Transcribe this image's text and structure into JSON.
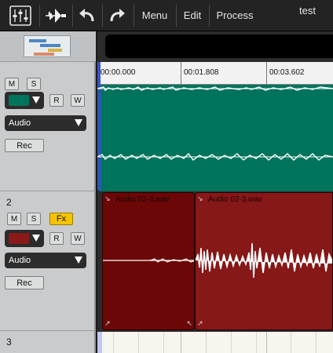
{
  "toolbar": {
    "mixer_icon": "mixer-faders-icon",
    "tool_icon": "waveform-tool-icon",
    "undo_icon": "undo-arrow-icon",
    "redo_icon": "redo-arrow-icon",
    "menu_label": "Menu",
    "edit_label": "Edit",
    "process_label": "Process",
    "project_title": "test"
  },
  "ruler": {
    "marks": [
      "00:00.000",
      "00:01.808",
      "00:03.602"
    ]
  },
  "tracks": [
    {
      "number": "",
      "mute": "M",
      "solo": "S",
      "read": "R",
      "write": "W",
      "color": "#00735c",
      "type": "Audio",
      "rec": "Rec"
    },
    {
      "number": "2",
      "mute": "M",
      "solo": "S",
      "fx": "Fx",
      "read": "R",
      "write": "W",
      "color": "#8a1a1a",
      "type": "Audio",
      "rec": "Rec"
    },
    {
      "number": "3"
    }
  ],
  "clips": {
    "track2_clip_a": "Audio 02-3.wav",
    "track2_clip_b": "Audio 02-3.wav"
  },
  "colors": {
    "track1_clip": "#00735c",
    "track2_clip_a": "#6c0707",
    "track2_clip_b": "#861818",
    "fx_active": "#f5c300",
    "playhead": "#3b4fd0"
  }
}
